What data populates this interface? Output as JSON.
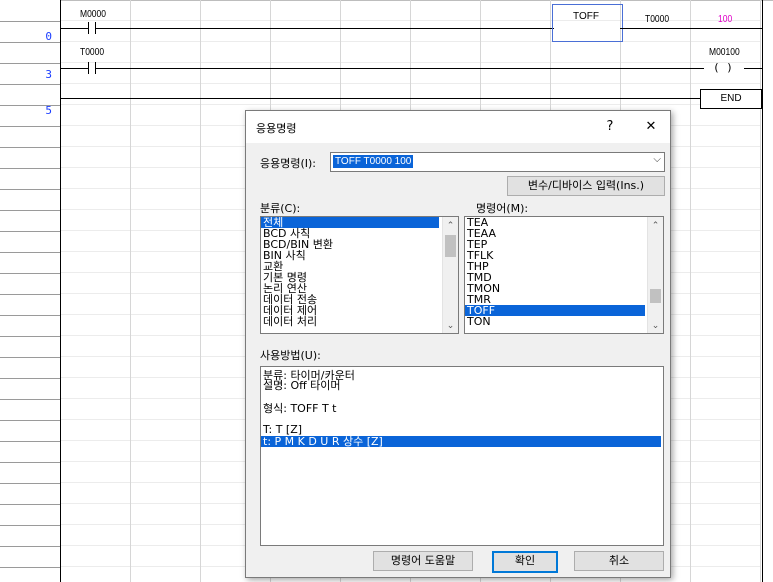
{
  "ladder": {
    "steps": [
      "0",
      "3",
      "5"
    ],
    "rung0": {
      "contact": "M0000",
      "instruction": "TOFF",
      "operand1": "T0000",
      "operand2": "100"
    },
    "rung3": {
      "contact": "T0000",
      "coil": "M00100"
    },
    "rung5": {
      "end": "END"
    },
    "colors": {
      "step_number": "#1a3cff",
      "constant": "#e000c8",
      "selection": "#4a6fd6"
    }
  },
  "dialog": {
    "title": "응용명령",
    "help_glyph": "?",
    "close_glyph": "✕",
    "instr_label": "응용명령(I):",
    "instr_value": "TOFF T0000 100",
    "var_button": "변수/디바이스 입력(Ins.)",
    "category_label": "분류(C):",
    "categories": [
      "전체",
      "BCD 사칙",
      "BCD/BIN 변환",
      "BIN 사칙",
      "교환",
      "기본 명령",
      "논리 연산",
      "데이터 전송",
      "데이터 제어",
      "데이터 처리"
    ],
    "instruction_label": "명령어(M):",
    "instructions": [
      "TEA",
      "TEAA",
      "TEP",
      "TFLK",
      "THP",
      "TMD",
      "TMON",
      "TMR",
      "TOFF",
      "TON"
    ],
    "usage_label": "사용방법(U):",
    "usage": {
      "line1": "분류: 타이머/카운터",
      "line2": "설명: Off 타이머",
      "line3": "형식: TOFF T t",
      "line4": "T:  T [Z]",
      "line5": "t:  P M K D U R 상수 [Z]"
    },
    "help_button": "명령어 도움말",
    "ok_button": "확인",
    "cancel_button": "취소"
  }
}
